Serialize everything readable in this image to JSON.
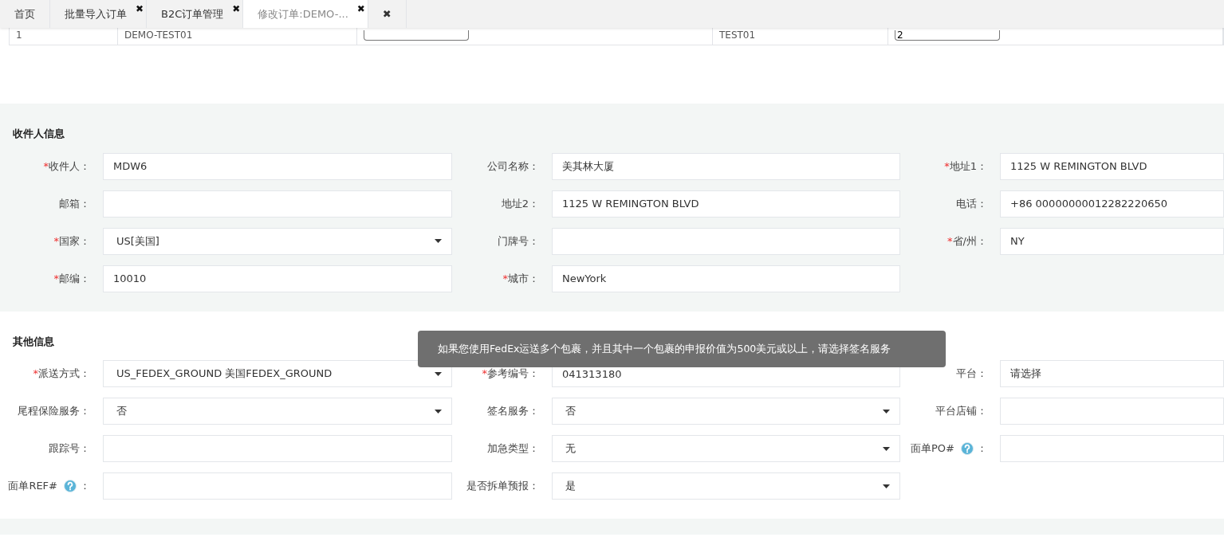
{
  "tabs": [
    {
      "label": "首页",
      "selected": false
    },
    {
      "label": "批量导入订单",
      "close": "✖",
      "selected": false
    },
    {
      "label": "B2C订单管理",
      "close": "✖",
      "selected": false
    },
    {
      "label": "修改订单:DEMO-...",
      "close": "✖",
      "selected": true
    },
    {
      "label": "✖",
      "selected": false
    }
  ],
  "table": {
    "row": [
      {
        "kind": "text",
        "text": "1"
      },
      {
        "kind": "text",
        "text": "DEMO-TEST01"
      },
      {
        "kind": "input"
      },
      {
        "kind": "text",
        "text": "TEST01"
      },
      {
        "kind": "input",
        "value": "2"
      }
    ]
  },
  "sections": [
    {
      "title": "收件人信息",
      "shaded": true,
      "fields": [
        {
          "mark": "*",
          "label": "收件人",
          "colon": "：",
          "kind": "input",
          "value": "MDW6"
        },
        {
          "label": "公司名称",
          "colon": "：",
          "kind": "input",
          "value": "美其林大厦"
        },
        {
          "mark": "*",
          "label": "地址1",
          "colon": "：",
          "kind": "input",
          "value": "1125 W REMINGTON BLVD"
        },
        {
          "label": "邮箱",
          "colon": "：",
          "kind": "input"
        },
        {
          "label": "地址2",
          "colon": "：",
          "kind": "input",
          "value": "1125 W REMINGTON BLVD"
        },
        {
          "label": "电话",
          "colon": "：",
          "kind": "input",
          "value": "+86 00000000012282220650"
        },
        {
          "mark": "*",
          "label": "国家",
          "colon": "：",
          "kind": "select",
          "value": "US[美国]"
        },
        {
          "label": "门牌号",
          "colon": "：",
          "kind": "input"
        },
        {
          "mark": "*",
          "label": "省/州",
          "colon": "：",
          "kind": "input",
          "value": "NY"
        },
        {
          "mark": "*",
          "label": "邮编",
          "colon": "：",
          "kind": "input",
          "value": "10010"
        },
        {
          "mark": "*",
          "label": "城市",
          "colon": "：",
          "kind": "input",
          "value": "NewYork"
        }
      ]
    },
    {
      "title": "其他信息",
      "shaded": false,
      "fields": [
        {
          "mark": "*",
          "label": "派送方式",
          "colon": "：",
          "kind": "select",
          "value": "US_FEDEX_GROUND 美国FEDEX_GROUND"
        },
        {
          "mark": "*",
          "label": "参考编号",
          "colon": "：",
          "kind": "input",
          "value": "041313180"
        },
        {
          "label": "平台",
          "colon": "：",
          "kind": "input",
          "value": "请选择"
        },
        {
          "label": "尾程保险服务",
          "colon": "：",
          "kind": "select",
          "value": "否"
        },
        {
          "label": "签名服务",
          "colon": "：",
          "kind": "select",
          "value": "否"
        },
        {
          "label": "平台店铺",
          "colon": "：",
          "kind": "input"
        },
        {
          "label": "跟踪号",
          "colon": "：",
          "kind": "input"
        },
        {
          "label": "加急类型",
          "colon": "：",
          "kind": "select",
          "value": "无"
        },
        {
          "label": "面单PO#",
          "help": true,
          "colon": "：",
          "kind": "input"
        },
        {
          "label": "面单REF#",
          "help": true,
          "colon": "：",
          "kind": "input"
        },
        {
          "label": "是否拆单预报",
          "colon": "：",
          "kind": "select",
          "value": "是"
        }
      ]
    }
  ],
  "tooltip": "如果您使用FedEx运送多个包裹，并且其中一个包裹的申报价值为500美元或以上，请选择签名服务"
}
